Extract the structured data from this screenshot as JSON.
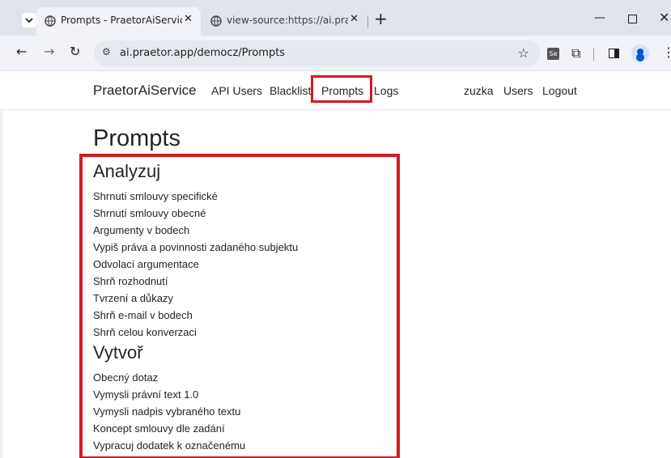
{
  "browser": {
    "tabs": [
      {
        "title": "Prompts - PraetorAiService",
        "close": "✕"
      },
      {
        "title": "view-source:https://ai.praetor.ai",
        "close": "✕"
      }
    ],
    "new_tab": "+",
    "url": "ai.praetor.app/democz/Prompts",
    "window_controls": {
      "minimize": "—",
      "maximize": "",
      "close": "✕"
    }
  },
  "site": {
    "brand": "PraetorAiService",
    "nav_left": [
      "API Users",
      "Blacklist",
      "Prompts",
      "Logs"
    ],
    "nav_right": [
      "zuzka",
      "Users",
      "Logout"
    ]
  },
  "page": {
    "title": "Prompts",
    "sections": [
      {
        "heading": "Analyzuj",
        "items": [
          "Shrnutí smlouvy specifické",
          "Shrnutí smlouvy obecné",
          "Argumenty v bodech",
          "Vypiš práva a povinnosti zadaného subjektu",
          "Odvolací argumentace",
          "Shrň rozhodnutí",
          "Tvrzení a důkazy",
          "Shrň e-mail v bodech",
          "Shrň celou konverzaci"
        ]
      },
      {
        "heading": "Vytvoř",
        "items": [
          "Obecný dotaz",
          "Vymysli právní text 1.0",
          "Vymysli nadpis vybraného textu",
          "Koncept smlouvy dle zadání",
          "Vypracuj dodatek k označenému"
        ]
      }
    ]
  },
  "colors": {
    "highlight": "#d71920",
    "tabstrip": "#dfe3eb",
    "toolbar": "#f1f3f8"
  },
  "icons": [
    "chevron-down-icon",
    "globe-icon",
    "back-arrow-icon",
    "forward-arrow-icon",
    "reload-icon",
    "site-info-icon",
    "star-icon",
    "extension-icon",
    "puzzle-icon",
    "side-panel-icon",
    "profile-icon",
    "menu-icon"
  ]
}
